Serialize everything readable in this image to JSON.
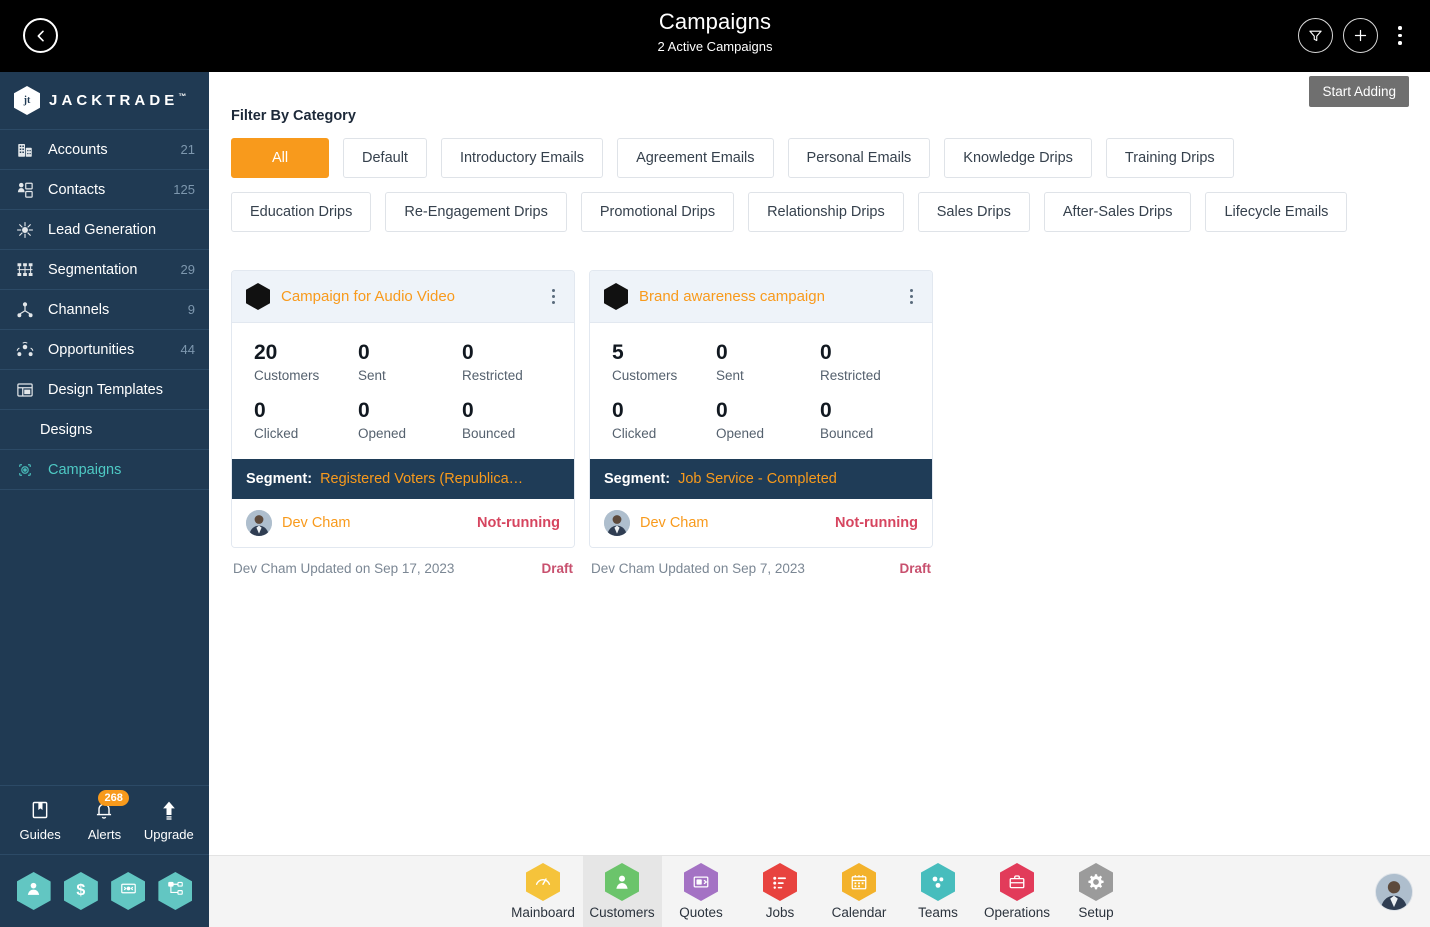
{
  "topbar": {
    "title": "Campaigns",
    "subtitle": "2 Active Campaigns",
    "back_icon": "chevron-left-icon",
    "filter_icon": "funnel-icon",
    "add_icon": "plus-icon",
    "more_icon": "kebab-menu-icon"
  },
  "tooltip": {
    "label": "Start Adding"
  },
  "sidebar": {
    "brand": {
      "mark": "jt",
      "name": "JACKTRADE",
      "tm": "™"
    },
    "items": [
      {
        "label": "Accounts",
        "count": "21",
        "icon": "building-icon",
        "active": false,
        "sub": false
      },
      {
        "label": "Contacts",
        "count": "125",
        "icon": "contacts-icon",
        "active": false,
        "sub": false
      },
      {
        "label": "Lead Generation",
        "count": "",
        "icon": "lead-gen-icon",
        "active": false,
        "sub": false
      },
      {
        "label": "Segmentation",
        "count": "29",
        "icon": "segmentation-icon",
        "active": false,
        "sub": false
      },
      {
        "label": "Channels",
        "count": "9",
        "icon": "channels-icon",
        "active": false,
        "sub": false
      },
      {
        "label": "Opportunities",
        "count": "44",
        "icon": "opportunities-icon",
        "active": false,
        "sub": false
      },
      {
        "label": "Design Templates",
        "count": "",
        "icon": "design-templates-icon",
        "active": false,
        "sub": false
      },
      {
        "label": "Designs",
        "count": "",
        "icon": "",
        "active": false,
        "sub": true
      },
      {
        "label": "Campaigns",
        "count": "",
        "icon": "campaigns-icon",
        "active": true,
        "sub": false
      }
    ],
    "tools": [
      {
        "label": "Guides",
        "icon": "book-icon",
        "badge": ""
      },
      {
        "label": "Alerts",
        "icon": "bell-icon",
        "badge": "268"
      },
      {
        "label": "Upgrade",
        "icon": "arrow-up-icon",
        "badge": ""
      }
    ],
    "quick_hexes": [
      {
        "icon": "person-icon",
        "color": "#62c6c2"
      },
      {
        "icon": "dollar-icon",
        "color": "#62c6c2"
      },
      {
        "icon": "payment-icon",
        "color": "#62c6c2"
      },
      {
        "icon": "workflow-icon",
        "color": "#62c6c2"
      }
    ]
  },
  "filters": {
    "title": "Filter By Category",
    "chips": [
      {
        "label": "All",
        "active": true
      },
      {
        "label": "Default",
        "active": false
      },
      {
        "label": "Introductory Emails",
        "active": false
      },
      {
        "label": "Agreement Emails",
        "active": false
      },
      {
        "label": "Personal Emails",
        "active": false
      },
      {
        "label": "Knowledge Drips",
        "active": false
      },
      {
        "label": "Training Drips",
        "active": false
      },
      {
        "label": "Education Drips",
        "active": false
      },
      {
        "label": "Re-Engagement Drips",
        "active": false
      },
      {
        "label": "Promotional Drips",
        "active": false
      },
      {
        "label": "Relationship Drips",
        "active": false
      },
      {
        "label": "Sales Drips",
        "active": false
      },
      {
        "label": "After-Sales Drips",
        "active": false
      },
      {
        "label": "Lifecycle Emails",
        "active": false
      }
    ]
  },
  "campaigns": {
    "segment_label": "Segment:",
    "cards": [
      {
        "title": "Campaign for Audio Video",
        "stats": [
          {
            "value": "20",
            "label": "Customers"
          },
          {
            "value": "0",
            "label": "Sent"
          },
          {
            "value": "0",
            "label": "Restricted"
          },
          {
            "value": "0",
            "label": "Clicked"
          },
          {
            "value": "0",
            "label": "Opened"
          },
          {
            "value": "0",
            "label": "Bounced"
          }
        ],
        "segment_value": "Registered Voters (Republica…",
        "owner": "Dev Cham",
        "status": "Not-running",
        "footer_meta": "Dev Cham Updated on Sep 17, 2023",
        "footer_state": "Draft"
      },
      {
        "title": "Brand awareness campaign",
        "stats": [
          {
            "value": "5",
            "label": "Customers"
          },
          {
            "value": "0",
            "label": "Sent"
          },
          {
            "value": "0",
            "label": "Restricted"
          },
          {
            "value": "0",
            "label": "Clicked"
          },
          {
            "value": "0",
            "label": "Opened"
          },
          {
            "value": "0",
            "label": "Bounced"
          }
        ],
        "segment_value": "Job Service - Completed",
        "owner": "Dev Cham",
        "status": "Not-running",
        "footer_meta": "Dev Cham Updated on Sep 7, 2023",
        "footer_state": "Draft"
      }
    ]
  },
  "bottombar": {
    "items": [
      {
        "label": "Mainboard",
        "icon": "mainboard-icon",
        "color": "#f5c33b",
        "active": false
      },
      {
        "label": "Customers",
        "icon": "customers-icon",
        "color": "#6bc46b",
        "active": true
      },
      {
        "label": "Quotes",
        "icon": "quotes-icon",
        "color": "#a472c4",
        "active": false
      },
      {
        "label": "Jobs",
        "icon": "jobs-icon",
        "color": "#e8433f",
        "active": false
      },
      {
        "label": "Calendar",
        "icon": "calendar-icon",
        "color": "#f3b22b",
        "active": false
      },
      {
        "label": "Teams",
        "icon": "teams-icon",
        "color": "#47bdbd",
        "active": false
      },
      {
        "label": "Operations",
        "icon": "operations-icon",
        "color": "#e23b5a",
        "active": false
      },
      {
        "label": "Setup",
        "icon": "setup-icon",
        "color": "#9b9b9b",
        "active": false
      }
    ],
    "avatar": "user-avatar"
  },
  "colors": {
    "accent_orange": "#f89a1c",
    "sidebar_bg": "#203a53",
    "segment_bg": "#1f3c57",
    "status_red": "#d6455f",
    "draft_pink": "#c8506e",
    "active_teal": "#4ec9c4"
  }
}
